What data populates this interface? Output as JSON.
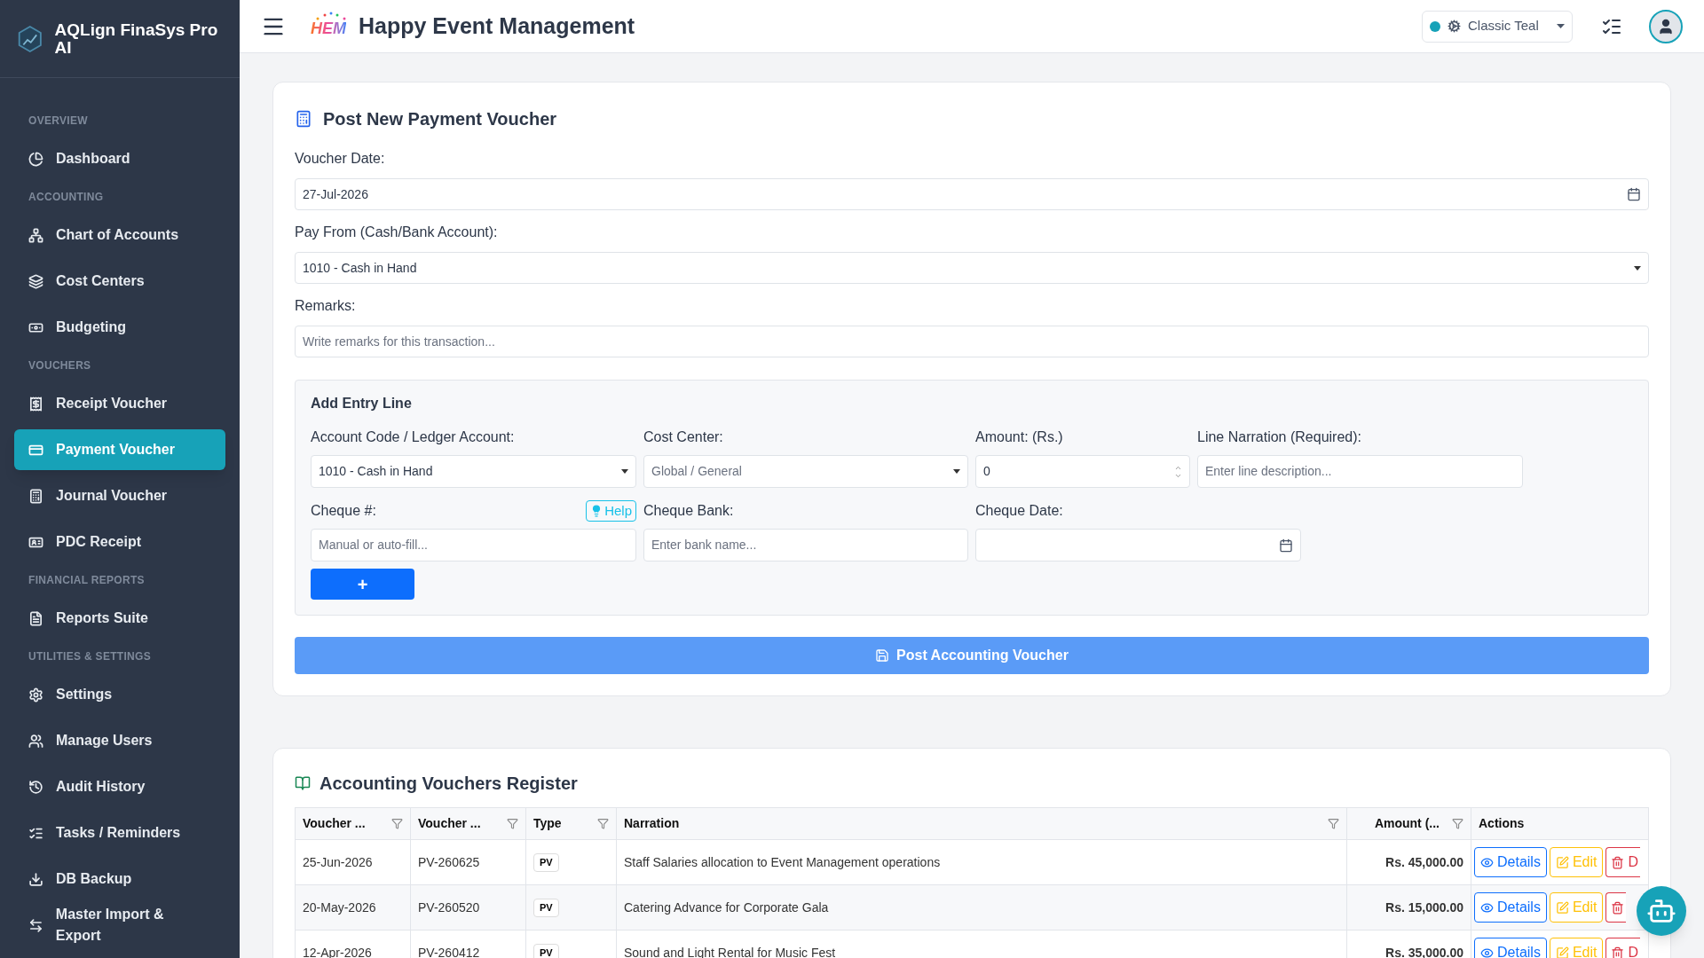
{
  "sidebar": {
    "brand": "AQLign FinaSys Pro AI",
    "sections": [
      {
        "heading": "OVERVIEW",
        "items": [
          {
            "label": "Dashboard",
            "selected": false
          }
        ]
      },
      {
        "heading": "ACCOUNTING",
        "items": [
          {
            "label": "Chart of Accounts",
            "selected": false
          },
          {
            "label": "Cost Centers",
            "selected": false
          },
          {
            "label": "Budgeting",
            "selected": false
          }
        ]
      },
      {
        "heading": "VOUCHERS",
        "items": [
          {
            "label": "Receipt Voucher",
            "selected": false
          },
          {
            "label": "Payment Voucher",
            "selected": true
          },
          {
            "label": "Journal Voucher",
            "selected": false
          },
          {
            "label": "PDC Receipt",
            "selected": false
          }
        ]
      },
      {
        "heading": "FINANCIAL REPORTS",
        "items": [
          {
            "label": "Reports Suite",
            "selected": false
          }
        ]
      },
      {
        "heading": "UTILITIES & SETTINGS",
        "items": [
          {
            "label": "Settings",
            "selected": false
          },
          {
            "label": "Manage Users",
            "selected": false
          },
          {
            "label": "Audit History",
            "selected": false
          },
          {
            "label": "Tasks / Reminders",
            "selected": false
          },
          {
            "label": "DB Backup",
            "selected": false
          },
          {
            "label": "Master Import & Export",
            "selected": false
          }
        ]
      }
    ]
  },
  "header": {
    "logo_text": "HEM",
    "title": "Happy Event Management",
    "theme": {
      "label": "Classic Teal",
      "color": "#17a2b8"
    }
  },
  "voucher_form": {
    "title": "Post New Payment Voucher",
    "fields": [
      {
        "kind": "date",
        "label": "Voucher Date:",
        "value": "27-Jul-2026"
      },
      {
        "kind": "select",
        "label": "Pay From (Cash/Bank Account):",
        "value": "1010 - Cash in Hand"
      },
      {
        "kind": "text",
        "label": "Remarks:",
        "placeholder": "Write remarks for this transaction..."
      }
    ],
    "entry_line": {
      "title": "Add Entry Line",
      "fields": [
        {
          "kind": "select",
          "label": "Account Code / Ledger Account:",
          "value": "1010 - Cash in Hand"
        },
        {
          "kind": "select",
          "label": "Cost Center:",
          "placeholder": "Global / General"
        },
        {
          "kind": "number",
          "label": "Amount: (Rs.)",
          "value": "0"
        },
        {
          "kind": "text",
          "label": "Line Narration (Required):",
          "placeholder": "Enter line description..."
        },
        {
          "kind": "text",
          "label": "Cheque #:",
          "placeholder": "Manual or auto-fill...",
          "help": "Help"
        },
        {
          "kind": "text",
          "label": "Cheque Bank:",
          "placeholder": "Enter bank name..."
        },
        {
          "kind": "date",
          "label": "Cheque Date:"
        }
      ],
      "add_button": "+"
    },
    "submit_button": "Post Accounting Voucher"
  },
  "register": {
    "title": "Accounting Vouchers Register",
    "columns": [
      {
        "label": "Voucher ...",
        "filterable": true
      },
      {
        "label": "Voucher ...",
        "filterable": true
      },
      {
        "label": "Type",
        "filterable": true
      },
      {
        "label": "Narration",
        "filterable": true
      },
      {
        "label": "Amount (...",
        "filterable": true
      },
      {
        "label": "Actions",
        "filterable": false
      }
    ],
    "rows": [
      {
        "date": "25-Jun-2026",
        "number": "PV-260625",
        "type": "PV",
        "narration": "Staff Salaries allocation to Event Management operations",
        "amount": "Rs. 45,000.00",
        "actions": [
          {
            "kind": "details",
            "label": "Details"
          },
          {
            "kind": "edit",
            "label": "Edit"
          },
          {
            "kind": "delete",
            "label": "D"
          }
        ]
      },
      {
        "date": "20-May-2026",
        "number": "PV-260520",
        "type": "PV",
        "narration": "Catering Advance for Corporate Gala",
        "amount": "Rs. 15,000.00",
        "actions": [
          {
            "kind": "details",
            "label": "Details"
          },
          {
            "kind": "edit",
            "label": "Edit"
          },
          {
            "kind": "delete"
          }
        ]
      },
      {
        "date": "12-Apr-2026",
        "number": "PV-260412",
        "type": "PV",
        "narration": "Sound and Light Rental for Music Fest",
        "amount": "Rs. 35,000.00",
        "actions": [
          {
            "kind": "details",
            "label": "Details"
          },
          {
            "kind": "edit",
            "label": "Edit"
          },
          {
            "kind": "delete",
            "label": "D"
          }
        ]
      }
    ]
  }
}
